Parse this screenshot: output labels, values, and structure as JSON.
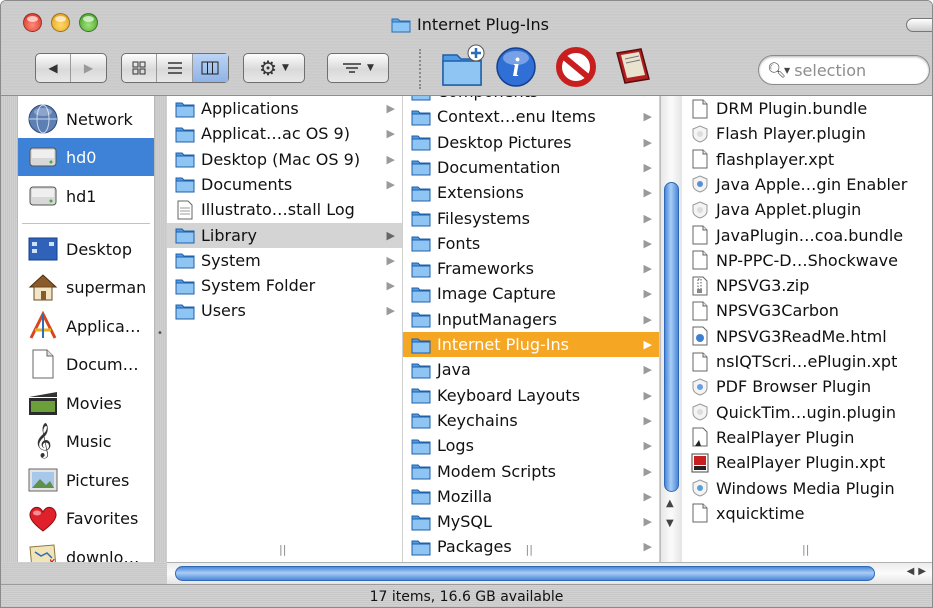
{
  "window": {
    "title": "Internet Plug-Ins",
    "status": "17 items, 16.6 GB available"
  },
  "toolbar": {
    "search_placeholder": "selection",
    "view_mode": "columns"
  },
  "sidebar": {
    "devices": [
      {
        "label": "Network",
        "icon": "network-globe-icon"
      },
      {
        "label": "hd0",
        "icon": "hard-disk-icon",
        "selected": true
      },
      {
        "label": "hd1",
        "icon": "hard-disk-icon"
      }
    ],
    "places": [
      {
        "label": "Desktop",
        "icon": "desktop-icon"
      },
      {
        "label": "superman",
        "icon": "home-icon"
      },
      {
        "label": "Applica…",
        "icon": "applications-icon"
      },
      {
        "label": "Docum…",
        "icon": "document-icon"
      },
      {
        "label": "Movies",
        "icon": "movies-icon"
      },
      {
        "label": "Music",
        "icon": "music-icon"
      },
      {
        "label": "Pictures",
        "icon": "pictures-icon"
      },
      {
        "label": "Favorites",
        "icon": "heart-icon"
      },
      {
        "label": "downlo…",
        "icon": "downloads-icon"
      }
    ]
  },
  "columns": {
    "col1": [
      {
        "label": "Applications",
        "icon": "folder-icon",
        "arrow": true
      },
      {
        "label": "Applicat…ac OS 9)",
        "icon": "folder-icon",
        "arrow": true
      },
      {
        "label": "Desktop (Mac OS 9)",
        "icon": "folder-icon",
        "arrow": true
      },
      {
        "label": "Documents",
        "icon": "folder-icon",
        "arrow": true
      },
      {
        "label": "Illustrato…stall Log",
        "icon": "text-file-icon",
        "arrow": false
      },
      {
        "label": "Library",
        "icon": "folder-icon",
        "arrow": true,
        "selected": "gray"
      },
      {
        "label": "System",
        "icon": "folder-icon",
        "arrow": true
      },
      {
        "label": "System Folder",
        "icon": "folder-icon",
        "arrow": true
      },
      {
        "label": "Users",
        "icon": "folder-icon",
        "arrow": true
      }
    ],
    "col2": [
      {
        "label": "Components",
        "icon": "folder-icon",
        "arrow": true,
        "partial": true
      },
      {
        "label": "Context…enu Items",
        "icon": "folder-icon",
        "arrow": true
      },
      {
        "label": "Desktop Pictures",
        "icon": "folder-icon",
        "arrow": true
      },
      {
        "label": "Documentation",
        "icon": "folder-icon",
        "arrow": true
      },
      {
        "label": "Extensions",
        "icon": "folder-icon",
        "arrow": true
      },
      {
        "label": "Filesystems",
        "icon": "folder-icon",
        "arrow": true
      },
      {
        "label": "Fonts",
        "icon": "folder-icon",
        "arrow": true
      },
      {
        "label": "Frameworks",
        "icon": "folder-icon",
        "arrow": true
      },
      {
        "label": "Image Capture",
        "icon": "folder-icon",
        "arrow": true
      },
      {
        "label": "InputManagers",
        "icon": "folder-icon",
        "arrow": true
      },
      {
        "label": "Internet Plug-Ins",
        "icon": "folder-icon",
        "arrow": true,
        "selected": "orange"
      },
      {
        "label": "Java",
        "icon": "folder-icon",
        "arrow": true
      },
      {
        "label": "Keyboard Layouts",
        "icon": "folder-icon",
        "arrow": true
      },
      {
        "label": "Keychains",
        "icon": "folder-icon",
        "arrow": true
      },
      {
        "label": "Logs",
        "icon": "folder-icon",
        "arrow": true
      },
      {
        "label": "Modem Scripts",
        "icon": "folder-icon",
        "arrow": true
      },
      {
        "label": "Mozilla",
        "icon": "folder-icon",
        "arrow": true
      },
      {
        "label": "MySQL",
        "icon": "folder-icon",
        "arrow": true
      },
      {
        "label": "Packages",
        "icon": "folder-icon",
        "arrow": true
      }
    ],
    "col3": [
      {
        "label": "DRM Plugin.bundle",
        "icon": "file-icon"
      },
      {
        "label": "Flash Player.plugin",
        "icon": "plugin-icon"
      },
      {
        "label": "flashplayer.xpt",
        "icon": "file-icon"
      },
      {
        "label": "Java Apple…gin Enabler",
        "icon": "java-plugin-icon"
      },
      {
        "label": "Java Applet.plugin",
        "icon": "plugin-icon"
      },
      {
        "label": "JavaPlugin…coa.bundle",
        "icon": "file-icon"
      },
      {
        "label": "NP-PPC-D…Shockwave",
        "icon": "file-icon"
      },
      {
        "label": "NPSVG3.zip",
        "icon": "zip-file-icon"
      },
      {
        "label": "NPSVG3Carbon",
        "icon": "file-icon"
      },
      {
        "label": "NPSVG3ReadMe.html",
        "icon": "html-file-icon"
      },
      {
        "label": "nsIQTScri…ePlugin.xpt",
        "icon": "file-icon"
      },
      {
        "label": "PDF Browser Plugin",
        "icon": "pdf-plugin-icon"
      },
      {
        "label": "QuickTim…ugin.plugin",
        "icon": "plugin-icon"
      },
      {
        "label": "RealPlayer Plugin",
        "icon": "realplayer-file-icon"
      },
      {
        "label": "RealPlayer Plugin.xpt",
        "icon": "realplayer-xpt-icon"
      },
      {
        "label": "Windows Media Plugin",
        "icon": "windows-media-plugin-icon"
      },
      {
        "label": "xquicktime",
        "icon": "file-icon"
      }
    ]
  }
}
